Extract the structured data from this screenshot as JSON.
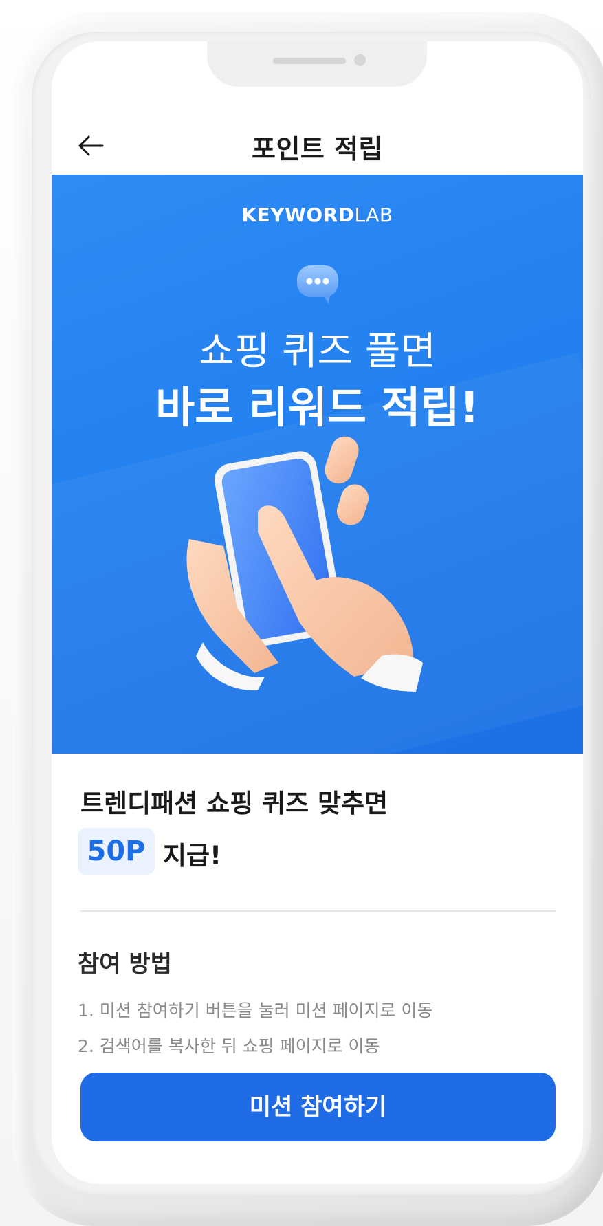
{
  "header": {
    "title": "포인트 적립",
    "back_icon": "arrow-left-icon"
  },
  "banner": {
    "logo_bold": "KEYWORD",
    "logo_light": "LAB",
    "headline_line1": "쇼핑 퀴즈 풀면",
    "headline_line2": "바로 리워드 적립!",
    "chat_icon": "chat-bubble-icon",
    "illustration": "hand-tapping-phone",
    "colors": {
      "gradient_start": "#2f8cf5",
      "gradient_end": "#1b6fe4"
    }
  },
  "reward": {
    "line1": "트렌디패션 쇼핑 퀴즈 맞추면",
    "points": "50P",
    "suffix": "지급!"
  },
  "howto": {
    "title": "참여 방법",
    "steps": [
      "1. 미션 참여하기 버튼을 눌러 미션 페이지로 이동",
      "2. 검색어를 복사한 뒤 쇼핑 페이지로 이동"
    ]
  },
  "cta": {
    "label": "미션 참여하기",
    "color": "#1f6ce6"
  }
}
